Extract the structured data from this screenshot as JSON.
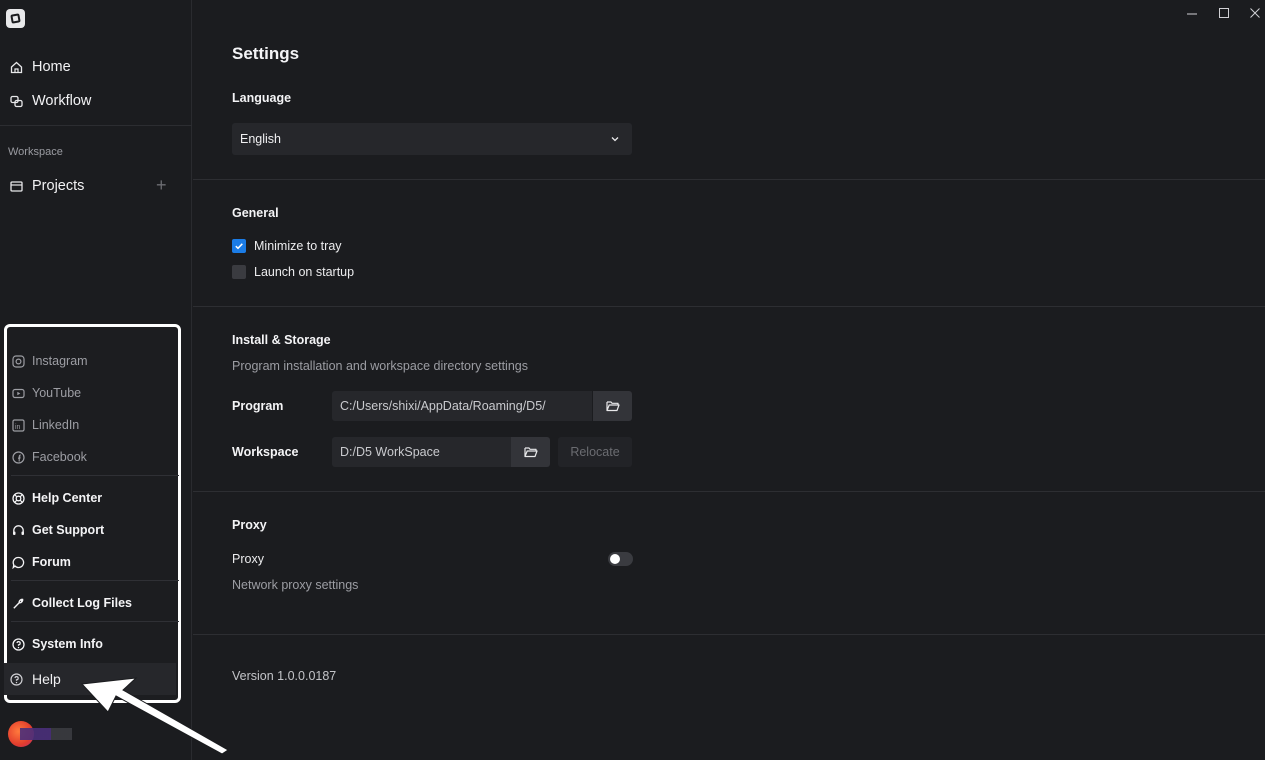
{
  "sidebar": {
    "nav": [
      {
        "label": "Home",
        "icon": "home-icon"
      },
      {
        "label": "Workflow",
        "icon": "workflow-icon"
      }
    ],
    "workspace_label": "Workspace",
    "projects_label": "Projects",
    "add_project_glyph": "+"
  },
  "help_menu": {
    "social": [
      {
        "label": "Instagram",
        "icon": "instagram-icon"
      },
      {
        "label": "YouTube",
        "icon": "youtube-icon"
      },
      {
        "label": "LinkedIn",
        "icon": "linkedin-icon"
      },
      {
        "label": "Facebook",
        "icon": "facebook-icon"
      }
    ],
    "support": [
      {
        "label": "Help Center",
        "icon": "lifebuoy-icon"
      },
      {
        "label": "Get Support",
        "icon": "headset-icon"
      },
      {
        "label": "Forum",
        "icon": "chat-icon"
      }
    ],
    "collect_logs": "Collect Log Files",
    "system_info": "System Info",
    "help_label": "Help"
  },
  "settings": {
    "title": "Settings",
    "language": {
      "title": "Language",
      "selected": "English"
    },
    "general": {
      "title": "General",
      "minimize_to_tray": {
        "label": "Minimize to tray",
        "checked": true
      },
      "launch_on_startup": {
        "label": "Launch on startup",
        "checked": false
      }
    },
    "install_storage": {
      "title": "Install & Storage",
      "description": "Program installation and workspace directory settings",
      "program_label": "Program",
      "program_path": "C:/Users/shixi/AppData/Roaming/D5/",
      "workspace_label": "Workspace",
      "workspace_path": "D:/D5 WorkSpace",
      "relocate_label": "Relocate"
    },
    "proxy": {
      "title": "Proxy",
      "label": "Proxy",
      "description": "Network proxy settings",
      "enabled": false
    },
    "version": "Version 1.0.0.0187"
  },
  "colors": {
    "background": "#1b1c1f",
    "accent": "#1b7ce6",
    "panel": "#26272b"
  }
}
